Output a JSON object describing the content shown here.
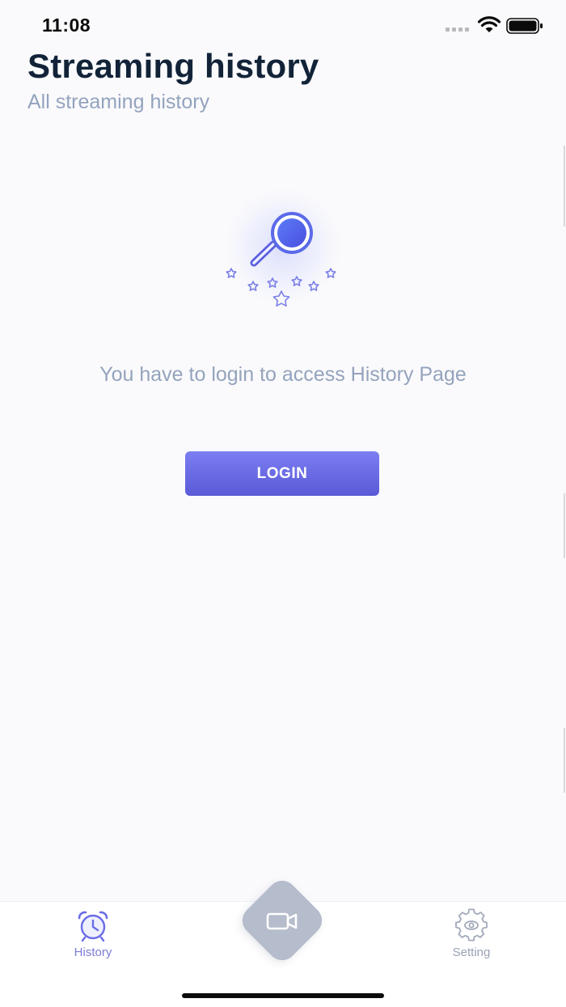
{
  "status_bar": {
    "time": "11:08"
  },
  "header": {
    "title": "Streaming history",
    "subtitle": "All streaming history"
  },
  "empty_state": {
    "illustration_icon": "magnifier-with-stars-icon",
    "message": "You have to login to access History Page",
    "login_label": "LOGIN"
  },
  "tab_bar": {
    "items": [
      {
        "label": "History",
        "icon": "alarm-clock-icon",
        "active": true
      },
      {
        "label": "Setting",
        "icon": "gear-icon",
        "active": false
      }
    ],
    "center_action_icon": "video-camera-icon"
  },
  "colors": {
    "accent": "#6b6de6",
    "title": "#122338",
    "muted_text": "#94a3bd",
    "background": "#fafafc",
    "center_action": "#b5bccb"
  }
}
